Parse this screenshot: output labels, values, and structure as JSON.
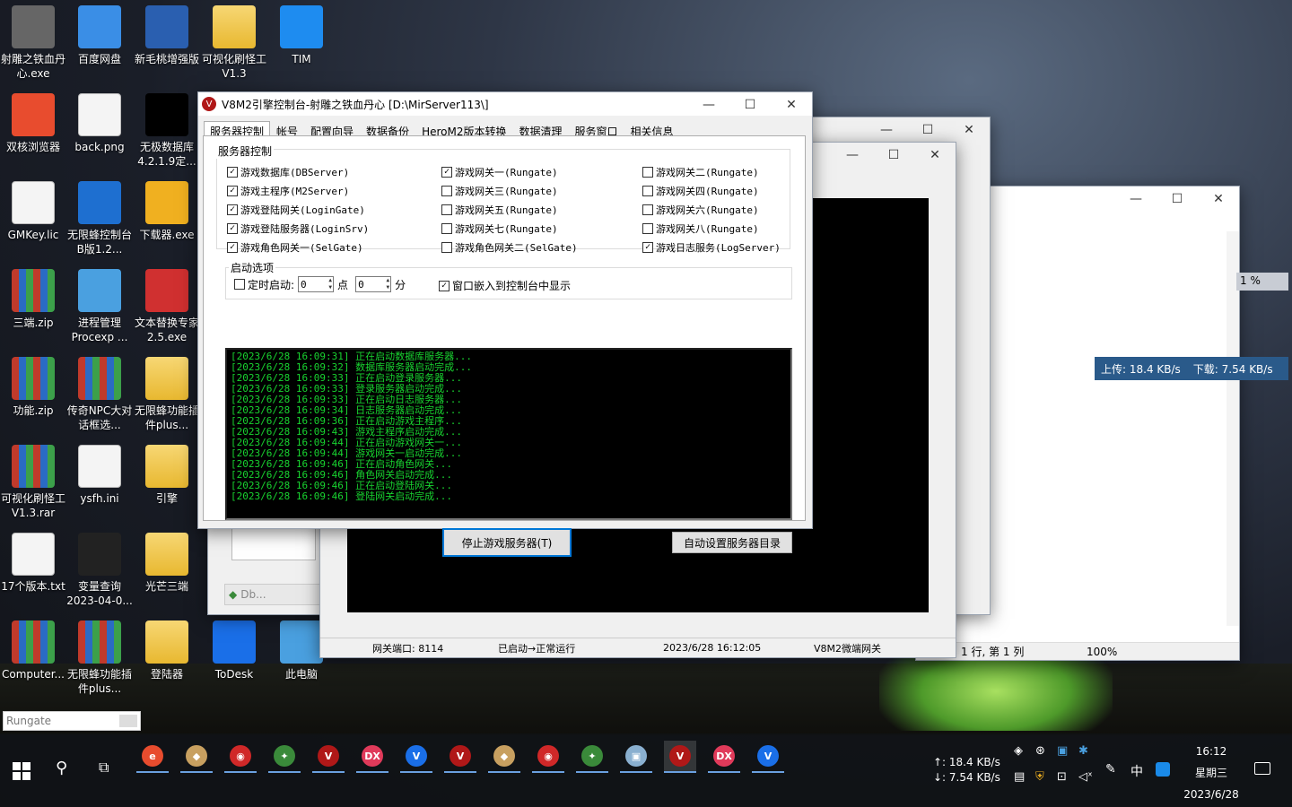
{
  "desktop_icons": [
    {
      "label": "射雕之铁血丹心.exe",
      "kind": "app",
      "color": "#666"
    },
    {
      "label": "百度网盘",
      "kind": "app",
      "color": "#3a8ee6"
    },
    {
      "label": "新毛桃增强版",
      "kind": "app",
      "color": "#2a5fb0"
    },
    {
      "label": "可视化刷怪工V1.3",
      "kind": "folder",
      "color": "#f0c850"
    },
    {
      "label": "TIM",
      "kind": "app",
      "color": "#1e8cf0"
    },
    {
      "label": "双核浏览器",
      "kind": "app",
      "color": "#e84c2e"
    },
    {
      "label": "back.png",
      "kind": "doc",
      "color": "#ddd"
    },
    {
      "label": "无极数据库4.2.1.9定...",
      "kind": "app",
      "color": "#000"
    },
    {
      "label": "GMKey.lic",
      "kind": "doc",
      "color": "#eee"
    },
    {
      "label": "无限蜂控制台B版1.2...",
      "kind": "app",
      "color": "#1e6fd0"
    },
    {
      "label": "下载器.exe",
      "kind": "app",
      "color": "#f0b020"
    },
    {
      "label": "三端.zip",
      "kind": "rar",
      "color": "#c03a2b"
    },
    {
      "label": "进程管理Procexp ...",
      "kind": "app",
      "color": "#4aa0e0"
    },
    {
      "label": "文本替换专家2.5.exe",
      "kind": "app",
      "color": "#d03030"
    },
    {
      "label": "功能.zip",
      "kind": "rar",
      "color": "#c03a2b"
    },
    {
      "label": "传奇NPC大对话框选...",
      "kind": "rar",
      "color": "#c03a2b"
    },
    {
      "label": "无限蜂功能插件plus...",
      "kind": "folder",
      "color": "#f0c850"
    },
    {
      "label": "可视化刷怪工V1.3.rar",
      "kind": "rar",
      "color": "#c03a2b"
    },
    {
      "label": "ysfh.ini",
      "kind": "doc",
      "color": "#eee"
    },
    {
      "label": "引擎",
      "kind": "folder",
      "color": "#f0c850"
    },
    {
      "label": "17个版本.txt",
      "kind": "doc",
      "color": "#fff"
    },
    {
      "label": "变量查询2023-04-0...",
      "kind": "app",
      "color": "#222"
    },
    {
      "label": "光芒三端",
      "kind": "folder",
      "color": "#f0c850"
    },
    {
      "label": "Computer...",
      "kind": "rar",
      "color": "#c03a2b"
    },
    {
      "label": "无限蜂功能插件plus...",
      "kind": "rar",
      "color": "#c03a2b"
    },
    {
      "label": "登陆器",
      "kind": "folder",
      "color": "#f0c850"
    },
    {
      "label": "ToDesk",
      "kind": "app",
      "color": "#1a6fe8"
    },
    {
      "label": "此电脑",
      "kind": "app",
      "color": "#4aa0e0"
    }
  ],
  "main_window": {
    "title": "V8M2引擎控制台-射雕之铁血丹心 [D:\\MirServer113\\]",
    "tabs": [
      "服务器控制",
      "帐号",
      "配置向导",
      "数据备份",
      "HeroM2版本转换",
      "数据清理",
      "服务窗口",
      "相关信息"
    ],
    "group_server": "服务器控制",
    "services": [
      {
        "label": "游戏数据库(DBServer)",
        "checked": true
      },
      {
        "label": "游戏主程序(M2Server)",
        "checked": true
      },
      {
        "label": "游戏登陆网关(LoginGate)",
        "checked": true
      },
      {
        "label": "游戏登陆服务器(LoginSrv)",
        "checked": true
      },
      {
        "label": "游戏角色网关一(SelGate)",
        "checked": true
      },
      {
        "label": "游戏网关一(Rungate)",
        "checked": true
      },
      {
        "label": "游戏网关三(Rungate)",
        "checked": false
      },
      {
        "label": "游戏网关五(Rungate)",
        "checked": false
      },
      {
        "label": "游戏网关七(Rungate)",
        "checked": false
      },
      {
        "label": "游戏角色网关二(SelGate)",
        "checked": false
      },
      {
        "label": "游戏网关二(Rungate)",
        "checked": false
      },
      {
        "label": "游戏网关四(Rungate)",
        "checked": false
      },
      {
        "label": "游戏网关六(Rungate)",
        "checked": false
      },
      {
        "label": "游戏网关八(Rungate)",
        "checked": false
      },
      {
        "label": "游戏日志服务(LogServer)",
        "checked": true
      }
    ],
    "group_startup": "启动选项",
    "timer_label": "定时启动:",
    "hour_value": "0",
    "hour_unit": "点",
    "minute_value": "0",
    "minute_unit": "分",
    "embed_label": "窗口嵌入到控制台中显示",
    "log_lines": [
      "[2023/6/28 16:09:31] 正在启动数据库服务器...",
      "[2023/6/28 16:09:32] 数据库服务器启动完成...",
      "[2023/6/28 16:09:33] 正在启动登录服务器...",
      "[2023/6/28 16:09:33] 登录服务器启动完成...",
      "[2023/6/28 16:09:33] 正在启动日志服务器...",
      "[2023/6/28 16:09:34] 日志服务器启动完成...",
      "[2023/6/28 16:09:36] 正在启动游戏主程序...",
      "[2023/6/28 16:09:43] 游戏主程序启动完成...",
      "[2023/6/28 16:09:44] 正在启动游戏网关一...",
      "[2023/6/28 16:09:44] 游戏网关一启动完成...",
      "[2023/6/28 16:09:46] 正在启动角色网关...",
      "[2023/6/28 16:09:46] 角色网关启动完成...",
      "[2023/6/28 16:09:46] 正在启动登陆网关...",
      "[2023/6/28 16:09:46] 登陆网关启动完成..."
    ],
    "stop_button": "停止游戏服务器(T)",
    "auto_dir_button": "自动设置服务器目录"
  },
  "gateway_window": {
    "status_port": "网关端口: 8114",
    "status_state": "已启动→正常运行",
    "status_time": "2023/6/28 16:12:05",
    "status_name": "V8M2微端网关"
  },
  "notepad_window": {
    "status_pos": "1 行, 第 1 列",
    "status_zoom": "100%"
  },
  "net_overlay": {
    "upload": "上传: 18.4 KB/s",
    "download": "下载: 7.54 KB/s",
    "percent": "1 %"
  },
  "back_window": {
    "item": "Db..."
  },
  "small_input": "Rungate",
  "tray": {
    "net_up": "↑: 18.4 KB/s",
    "net_down": "↓: 7.54 KB/s",
    "ime": "中",
    "time": "16:12",
    "weekday": "星期三",
    "date": "2023/6/28"
  },
  "taskbar_apps": [
    {
      "name": "chrome",
      "color": "#e84c2e",
      "text": "e"
    },
    {
      "name": "app-cat",
      "color": "#c8a060",
      "text": "◆"
    },
    {
      "name": "app-red",
      "color": "#d02828",
      "text": "◉"
    },
    {
      "name": "app-tool",
      "color": "#3a8a3a",
      "text": "✦"
    },
    {
      "name": "v-red",
      "color": "#b01818",
      "text": "V"
    },
    {
      "name": "dx",
      "color": "#e03a5a",
      "text": "DX"
    },
    {
      "name": "v-blue",
      "color": "#1a6fe8",
      "text": "V"
    },
    {
      "name": "v-red-2",
      "color": "#b01818",
      "text": "V"
    },
    {
      "name": "app-cat-2",
      "color": "#c8a060",
      "text": "◆"
    },
    {
      "name": "app-red-2",
      "color": "#d02828",
      "text": "◉"
    },
    {
      "name": "app-tool-2",
      "color": "#3a8a3a",
      "text": "✦"
    },
    {
      "name": "app-cube",
      "color": "#8ab0d0",
      "text": "▣"
    },
    {
      "name": "v-red-active",
      "color": "#b01818",
      "text": "V"
    },
    {
      "name": "dx-2",
      "color": "#e03a5a",
      "text": "DX"
    },
    {
      "name": "v-blue-2",
      "color": "#1a6fe8",
      "text": "V"
    }
  ]
}
